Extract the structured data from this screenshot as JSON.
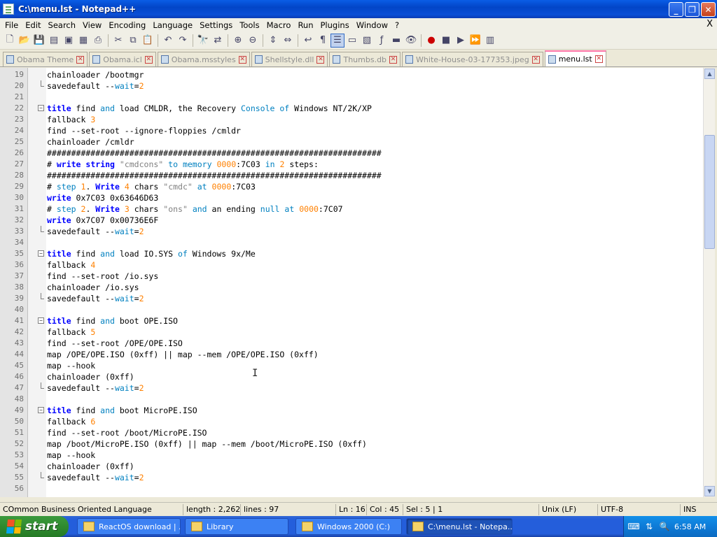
{
  "window": {
    "title": "C:\\menu.lst - Notepad++"
  },
  "menu": [
    "File",
    "Edit",
    "Search",
    "View",
    "Encoding",
    "Language",
    "Settings",
    "Tools",
    "Macro",
    "Run",
    "Plugins",
    "Window",
    "?"
  ],
  "menu_close": "X",
  "tabs": [
    {
      "label": "Obama Theme",
      "active": false
    },
    {
      "label": "Obama.icl",
      "active": false
    },
    {
      "label": "Obama.msstyles",
      "active": false
    },
    {
      "label": "Shellstyle.dll",
      "active": false
    },
    {
      "label": "Thumbs.db",
      "active": false
    },
    {
      "label": "White-House-03-177353.jpeg",
      "active": false
    },
    {
      "label": "menu.lst",
      "active": true
    }
  ],
  "editor": {
    "lines": [
      {
        "n": "19",
        "text": "chainloader /bootmgr"
      },
      {
        "n": "20",
        "text": "savedefault --wait=2",
        "fold": "end"
      },
      {
        "n": "21",
        "text": ""
      },
      {
        "n": "22",
        "text": "title find and load CMLDR, the Recovery Console of Windows NT/2K/XP",
        "fold": "start"
      },
      {
        "n": "23",
        "text": "fallback 3"
      },
      {
        "n": "24",
        "text": "find --set-root --ignore-floppies /cmldr"
      },
      {
        "n": "25",
        "text": "chainloader /cmldr"
      },
      {
        "n": "26",
        "text": "#####################################################################"
      },
      {
        "n": "27",
        "text": "# write string \"cmdcons\" to memory 0000:7C03 in 2 steps:"
      },
      {
        "n": "28",
        "text": "#####################################################################"
      },
      {
        "n": "29",
        "text": "# step 1. Write 4 chars \"cmdc\" at 0000:7C03"
      },
      {
        "n": "30",
        "text": "write 0x7C03 0x63646D63"
      },
      {
        "n": "31",
        "text": "# step 2. Write 3 chars \"ons\" and an ending null at 0000:7C07"
      },
      {
        "n": "32",
        "text": "write 0x7C07 0x00736E6F"
      },
      {
        "n": "33",
        "text": "savedefault --wait=2",
        "fold": "end"
      },
      {
        "n": "34",
        "text": ""
      },
      {
        "n": "35",
        "text": "title find and load IO.SYS of Windows 9x/Me",
        "fold": "start"
      },
      {
        "n": "36",
        "text": "fallback 4"
      },
      {
        "n": "37",
        "text": "find --set-root /io.sys"
      },
      {
        "n": "38",
        "text": "chainloader /io.sys"
      },
      {
        "n": "39",
        "text": "savedefault --wait=2",
        "fold": "end"
      },
      {
        "n": "40",
        "text": ""
      },
      {
        "n": "41",
        "text": "title find and boot OPE.ISO",
        "fold": "start"
      },
      {
        "n": "42",
        "text": "fallback 5"
      },
      {
        "n": "43",
        "text": "find --set-root /OPE/OPE.ISO"
      },
      {
        "n": "44",
        "text": "map /OPE/OPE.ISO (0xff) || map --mem /OPE/OPE.ISO (0xff)"
      },
      {
        "n": "45",
        "text": "map --hook"
      },
      {
        "n": "46",
        "text": "chainloader (0xff)"
      },
      {
        "n": "47",
        "text": "savedefault --wait=2",
        "fold": "end"
      },
      {
        "n": "48",
        "text": ""
      },
      {
        "n": "49",
        "text": "title find and boot MicroPE.ISO",
        "fold": "start"
      },
      {
        "n": "50",
        "text": "fallback 6"
      },
      {
        "n": "51",
        "text": "find --set-root /boot/MicroPE.ISO"
      },
      {
        "n": "52",
        "text": "map /boot/MicroPE.ISO (0xff) || map --mem /boot/MicroPE.ISO (0xff)"
      },
      {
        "n": "53",
        "text": "map --hook"
      },
      {
        "n": "54",
        "text": "chainloader (0xff)"
      },
      {
        "n": "55",
        "text": "savedefault --wait=2",
        "fold": "end"
      },
      {
        "n": "56",
        "text": ""
      }
    ]
  },
  "statusbar": {
    "language": "COmmon Business Oriented Language",
    "length": "length : 2,262",
    "lines": "lines : 97",
    "ln": "Ln : 16",
    "col": "Col : 45",
    "sel": "Sel : 5 | 1",
    "eol": "Unix (LF)",
    "encoding": "UTF-8",
    "mode": "INS"
  },
  "taskbar": {
    "start": "start",
    "tasks": [
      {
        "label": "ReactOS download | ...",
        "active": false
      },
      {
        "label": "Library",
        "active": false
      },
      {
        "label": "Windows 2000 (C:)",
        "active": false
      },
      {
        "label": "C:\\menu.lst - Notepa...",
        "active": true
      }
    ],
    "clock": "6:58 AM"
  },
  "colors": {
    "keyword": "#0000ff",
    "number": "#ff8000",
    "string": "#808080",
    "builtin": "#0080c0"
  }
}
